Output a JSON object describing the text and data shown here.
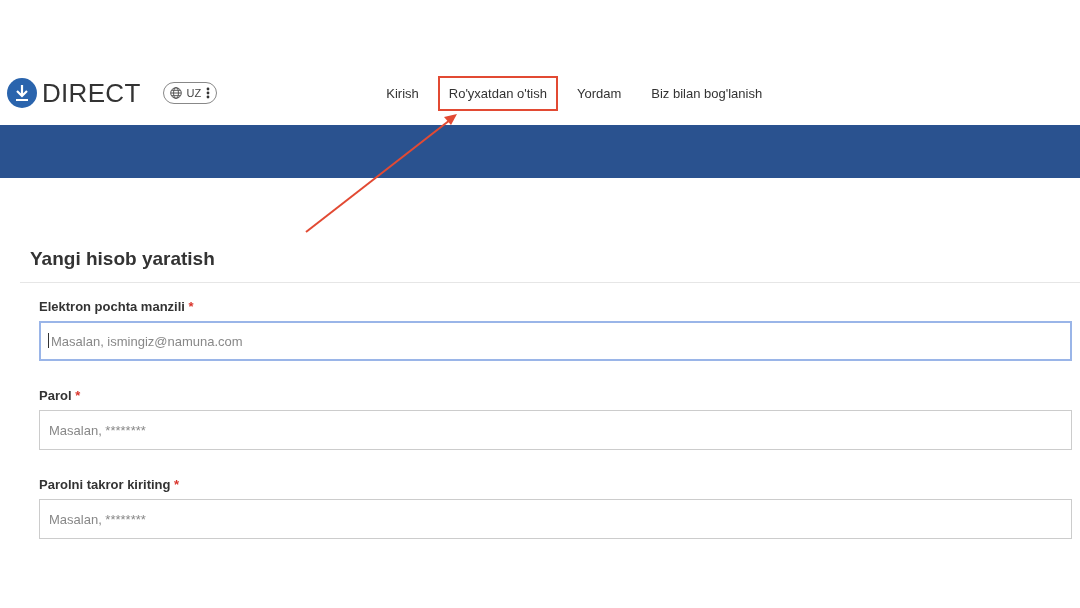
{
  "header": {
    "logo_text": "DIRECT",
    "language": "UZ",
    "nav": [
      {
        "label": "Kirish",
        "highlighted": false
      },
      {
        "label": "Ro'yxatdan o'tish",
        "highlighted": true
      },
      {
        "label": "Yordam",
        "highlighted": false
      },
      {
        "label": "Biz bilan bog'lanish",
        "highlighted": false
      }
    ]
  },
  "form": {
    "title": "Yangi hisob yaratish",
    "fields": [
      {
        "label": "Elektron pochta manzili",
        "required_mark": "*",
        "placeholder": "Masalan, ismingiz@namuna.com",
        "focused": true
      },
      {
        "label": "Parol",
        "required_mark": "*",
        "placeholder": "Masalan, ********",
        "focused": false
      },
      {
        "label": "Parolni takror kiriting",
        "required_mark": "*",
        "placeholder": "Masalan, ********",
        "focused": false
      }
    ]
  }
}
